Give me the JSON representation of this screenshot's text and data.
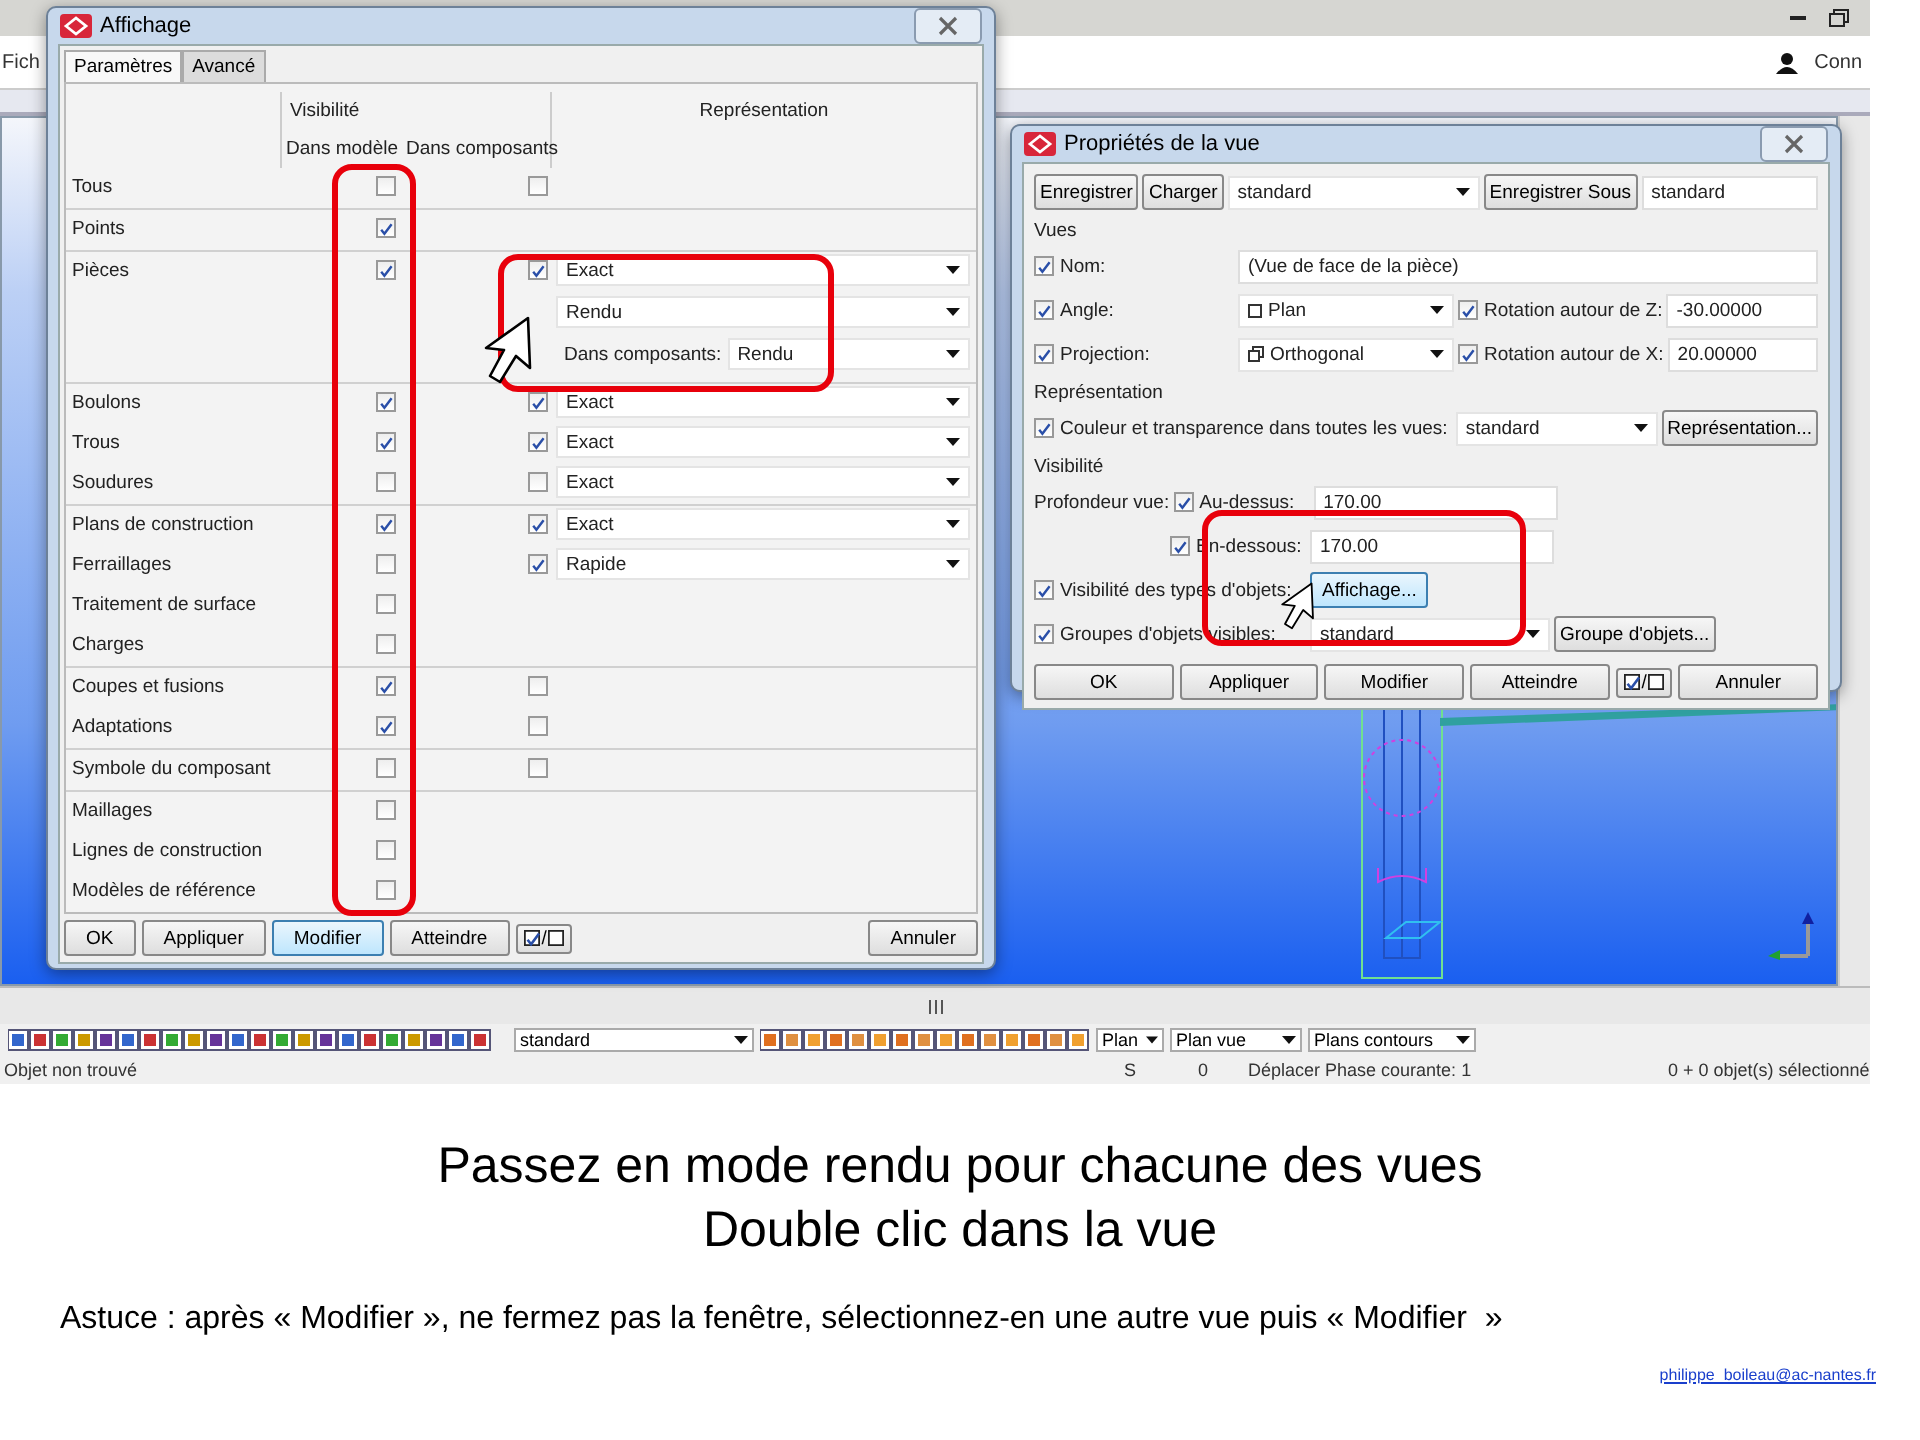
{
  "app": {
    "menu_fragment": "Fich",
    "user_label": "Conn",
    "bottom_toolbar": {
      "view_filter": "standard",
      "plane": "Plan",
      "plane_view": "Plan vue",
      "contour_planes": "Plans contours"
    },
    "status_bar": {
      "message": "Objet non trouvé",
      "snap": "S",
      "count": "0",
      "action": "Déplacer Phase courante: 1",
      "selection": "0 + 0 objet(s) sélectionné"
    }
  },
  "display_dialog": {
    "title": "Affichage",
    "tabs": [
      {
        "label": "Paramètres",
        "selected": true
      },
      {
        "label": "Avancé",
        "selected": false
      }
    ],
    "headers": {
      "visibility": "Visibilité",
      "in_model": "Dans modèle",
      "in_components": "Dans composants",
      "representation": "Représentation"
    },
    "groups": [
      {
        "rows": [
          {
            "label": "Tous",
            "in_model": false,
            "in_components": false
          }
        ]
      },
      {
        "rows": [
          {
            "label": "Points",
            "in_model": true
          }
        ]
      },
      {
        "rows": [
          {
            "label": "Pièces",
            "in_model": true,
            "in_components": true,
            "representation": "Exact",
            "extra": [
              {
                "value": "Rendu"
              },
              {
                "label": "Dans composants:",
                "value": "Rendu"
              }
            ]
          }
        ]
      },
      {
        "rows": [
          {
            "label": "Boulons",
            "in_model": true,
            "in_components": true,
            "representation": "Exact"
          },
          {
            "label": "Trous",
            "in_model": true,
            "in_components": true,
            "representation": "Exact"
          },
          {
            "label": "Soudures",
            "in_model": false,
            "in_components": false,
            "representation": "Exact"
          }
        ]
      },
      {
        "rows": [
          {
            "label": "Plans de construction",
            "in_model": true,
            "in_components": true,
            "representation": "Exact"
          },
          {
            "label": "Ferraillages",
            "in_model": false,
            "in_components": true,
            "representation": "Rapide"
          },
          {
            "label": "Traitement de surface",
            "in_model": false
          },
          {
            "label": "Charges",
            "in_model": false
          }
        ]
      },
      {
        "rows": [
          {
            "label": "Coupes et fusions",
            "in_model": true,
            "in_components": false
          },
          {
            "label": "Adaptations",
            "in_model": true,
            "in_components": false
          }
        ]
      },
      {
        "rows": [
          {
            "label": "Symbole du composant",
            "in_model": false,
            "in_components": false
          }
        ]
      },
      {
        "rows": [
          {
            "label": "Maillages",
            "in_model": false
          },
          {
            "label": "Lignes de construction",
            "in_model": false
          },
          {
            "label": "Modèles de référence",
            "in_model": false
          }
        ]
      }
    ],
    "buttons": [
      {
        "kind": "button",
        "label": "OK",
        "focused": false
      },
      {
        "kind": "button",
        "label": "Appliquer",
        "focused": false
      },
      {
        "kind": "button",
        "label": "Modifier",
        "focused": true
      },
      {
        "kind": "button",
        "label": "Atteindre",
        "focused": false
      },
      {
        "kind": "toggle",
        "label": "/"
      },
      {
        "kind": "spacer"
      },
      {
        "kind": "button",
        "label": "Annuler",
        "focused": false
      }
    ]
  },
  "view_properties_dialog": {
    "title": "Propriétés de la vue",
    "top_bar": {
      "save": "Enregistrer",
      "load": "Charger",
      "preset": "standard",
      "save_as": "Enregistrer Sous",
      "save_as_name": "standard"
    },
    "views_section": {
      "title": "Vues",
      "name": {
        "label": "Nom:",
        "checked": true,
        "value": "(Vue de face de la pièce)"
      },
      "angle": {
        "label": "Angle:",
        "checked": true,
        "value": "Plan"
      },
      "rotation_z": {
        "label": "Rotation autour de Z:",
        "checked": true,
        "value": "-30.00000"
      },
      "projection": {
        "label": "Projection:",
        "checked": true,
        "value": "Orthogonal"
      },
      "rotation_x": {
        "label": "Rotation autour de X:",
        "checked": true,
        "value": "20.00000"
      }
    },
    "representation_section": {
      "title": "Représentation",
      "color": {
        "label": "Couleur et transparence dans toutes les vues:",
        "checked": true,
        "value": "standard"
      },
      "button": "Représentation..."
    },
    "visibility_section": {
      "title": "Visibilité",
      "depth_label": "Profondeur vue:",
      "above": {
        "label": "Au-dessus:",
        "checked": true,
        "value": "170.00"
      },
      "below": {
        "label": "En-dessous:",
        "checked": true,
        "value": "170.00"
      },
      "object_types": {
        "label": "Visibilité des types d'objets:",
        "checked": true,
        "button": "Affichage...",
        "hovered": true
      },
      "object_groups": {
        "label": "Groupes d'objets visibles:",
        "checked": true,
        "value": "standard",
        "button": "Groupe d'objets..."
      }
    },
    "buttons": [
      {
        "kind": "button",
        "label": "OK",
        "focused": false
      },
      {
        "kind": "button",
        "label": "Appliquer",
        "focused": false
      },
      {
        "kind": "button",
        "label": "Modifier",
        "focused": false
      },
      {
        "kind": "button",
        "label": "Atteindre",
        "focused": false
      },
      {
        "kind": "toggle",
        "label": "/"
      },
      {
        "kind": "button",
        "label": "Annuler",
        "focused": false
      }
    ]
  },
  "slide": {
    "headline": [
      "Passez en mode rendu pour chacune des vues",
      "Double clic dans la vue"
    ],
    "tip": "Astuce : après « Modifier », ne fermez pas la fenêtre, sélectionnez-en une autre vue puis « Modifier  »",
    "author_link": "philippe_boileau@ac-nantes.fr"
  }
}
